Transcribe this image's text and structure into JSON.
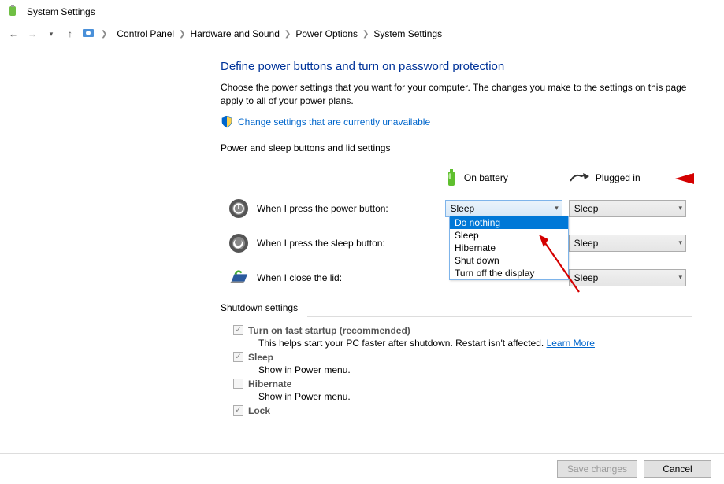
{
  "window": {
    "title": "System Settings"
  },
  "breadcrumb": {
    "items": [
      "Control Panel",
      "Hardware and Sound",
      "Power Options",
      "System Settings"
    ]
  },
  "heading": "Define power buttons and turn on password protection",
  "description": "Choose the power settings that you want for your computer. The changes you make to the settings on this page apply to all of your power plans.",
  "shield_link": "Change settings that are currently unavailable",
  "section1": {
    "label": "Power and sleep buttons and lid settings",
    "col_headers": {
      "battery": "On battery",
      "plugged": "Plugged in"
    },
    "rows": {
      "power": {
        "label": "When I press the power button:",
        "battery_value": "Sleep",
        "plugged_value": "Sleep"
      },
      "sleep": {
        "label": "When I press the sleep button:",
        "plugged_value": "Sleep"
      },
      "lid": {
        "label": "When I close the lid:",
        "plugged_value": "Sleep"
      }
    },
    "dropdown_options": [
      "Do nothing",
      "Sleep",
      "Hibernate",
      "Shut down",
      "Turn off the display"
    ]
  },
  "section2": {
    "label": "Shutdown settings",
    "items": {
      "fast": {
        "title": "Turn on fast startup (recommended)",
        "sub": "This helps start your PC faster after shutdown. Restart isn't affected.",
        "link": "Learn More"
      },
      "slp": {
        "title": "Sleep",
        "sub": "Show in Power menu."
      },
      "hib": {
        "title": "Hibernate",
        "sub": "Show in Power menu."
      },
      "lock": {
        "title": "Lock"
      }
    }
  },
  "footer": {
    "save": "Save changes",
    "cancel": "Cancel"
  }
}
